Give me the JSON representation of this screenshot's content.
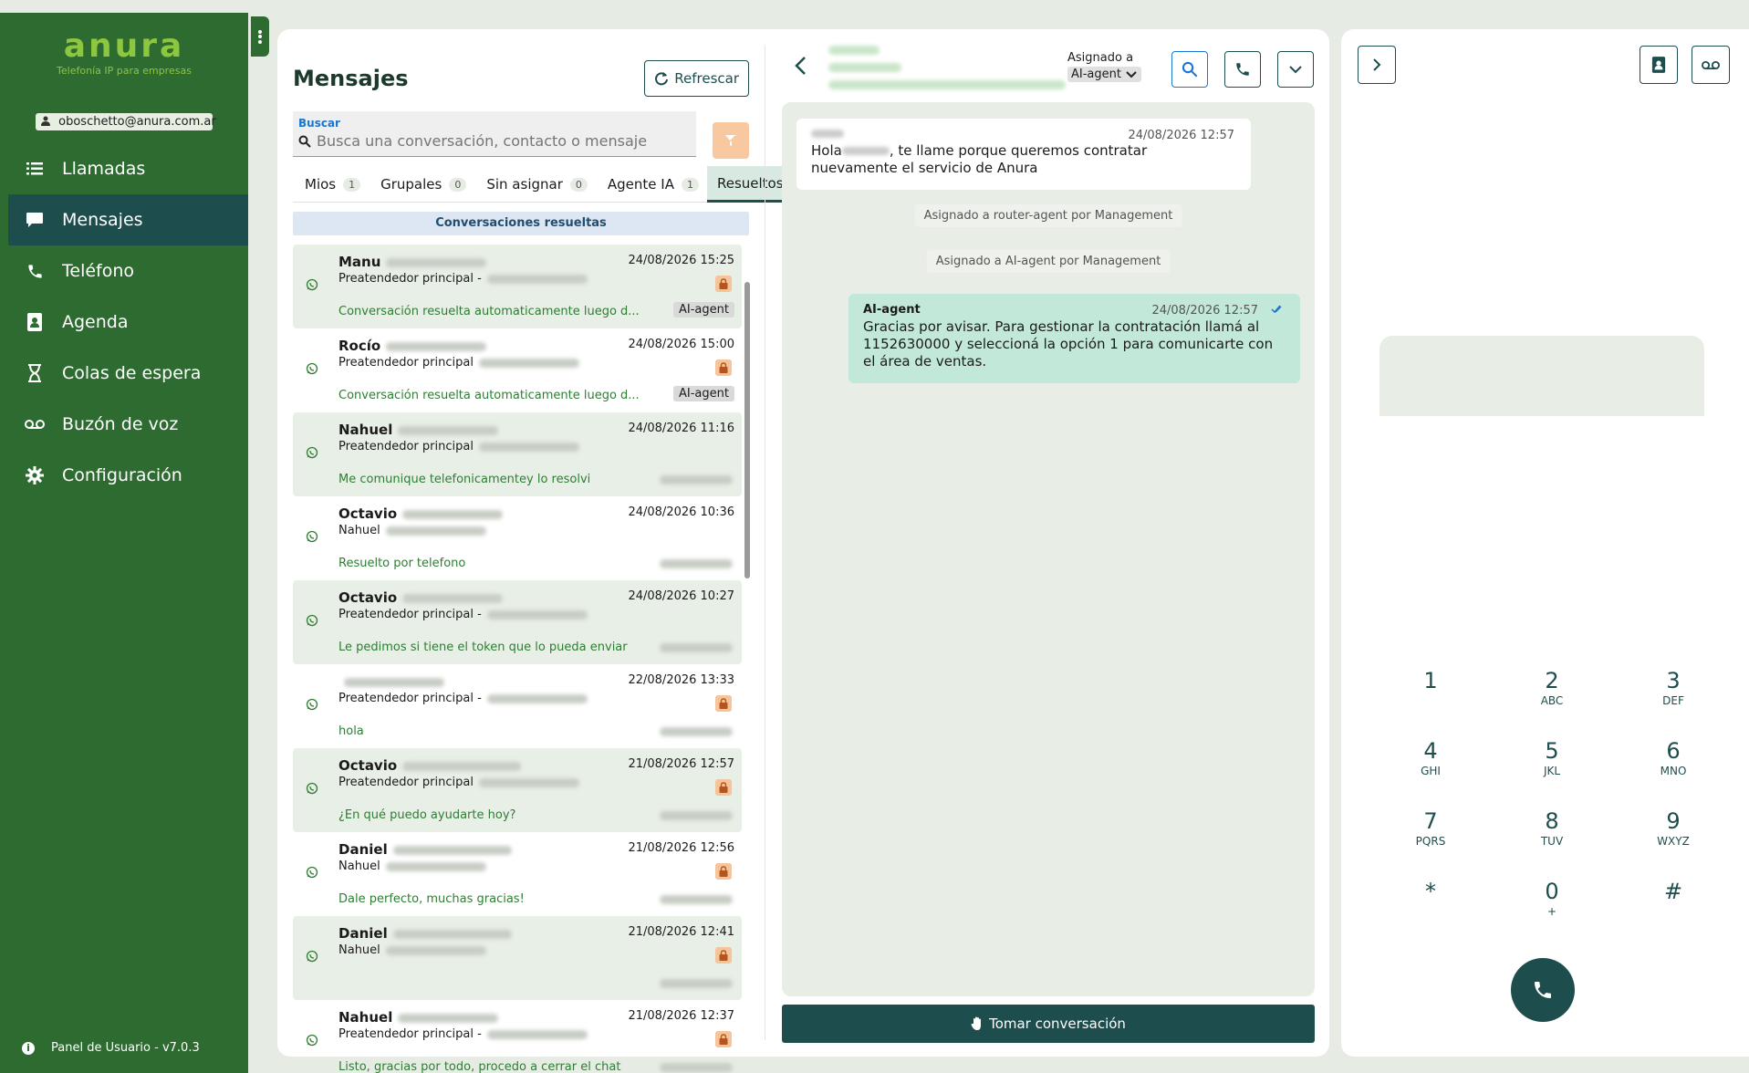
{
  "brand": {
    "logo": "anura",
    "tagline": "Telefonía IP para empresas"
  },
  "user": {
    "email": "oboschetto@anura.com.ar"
  },
  "sidebar": {
    "items": [
      {
        "label": "Llamadas",
        "icon": "list-icon"
      },
      {
        "label": "Mensajes",
        "icon": "chat-icon"
      },
      {
        "label": "Teléfono",
        "icon": "phone-icon"
      },
      {
        "label": "Agenda",
        "icon": "contact-book-icon"
      },
      {
        "label": "Colas de espera",
        "icon": "hourglass-icon"
      },
      {
        "label": "Buzón de voz",
        "icon": "voicemail-icon"
      },
      {
        "label": "Configuración",
        "icon": "gear-icon"
      }
    ],
    "footer": "Panel de Usuario - v7.0.3"
  },
  "messages": {
    "title": "Mensajes",
    "refresh_label": "Refrescar",
    "search": {
      "label": "Buscar",
      "placeholder": "Busca una conversación, contacto o mensaje"
    },
    "tabs": [
      {
        "label": "Mios",
        "count": "1"
      },
      {
        "label": "Grupales",
        "count": "0"
      },
      {
        "label": "Sin asignar",
        "count": "0"
      },
      {
        "label": "Agente IA",
        "count": "1"
      },
      {
        "label": "Resueltos",
        "count": ""
      }
    ],
    "section_title": "Conversaciones resueltas",
    "conversations": [
      {
        "name": "Manu",
        "sub": "Preatendedor principal -",
        "time": "24/08/2026 15:25",
        "preview": "Conversación resuelta automaticamente luego d...",
        "tag": "AI-agent"
      },
      {
        "name": "Rocío",
        "sub": "Preatendedor principal",
        "time": "24/08/2026 15:00",
        "preview": "Conversación resuelta automaticamente luego d...",
        "tag": "AI-agent"
      },
      {
        "name": "Nahuel",
        "sub": "Preatendedor principal",
        "time": "24/08/2026 11:16",
        "preview": "Me comunique telefonicamentey lo resolvi",
        "tag": ""
      },
      {
        "name": "Octavio",
        "sub": "Nahuel",
        "time": "24/08/2026 10:36",
        "preview": "Resuelto por telefono",
        "tag": ""
      },
      {
        "name": "Octavio",
        "sub": "Preatendedor principal -",
        "time": "24/08/2026 10:27",
        "preview": "Le pedimos si tiene el token que lo pueda enviar",
        "tag": ""
      },
      {
        "name": "",
        "sub": "Preatendedor principal -",
        "time": "22/08/2026 13:33",
        "preview": "hola",
        "tag": ""
      },
      {
        "name": "Octavio",
        "sub": "Preatendedor principal",
        "time": "21/08/2026 12:57",
        "preview": "¿En qué puedo ayudarte hoy?",
        "tag": ""
      },
      {
        "name": "Daniel",
        "sub": "Nahuel",
        "time": "21/08/2026 12:56",
        "preview": "Dale perfecto, muchas gracias!",
        "tag": ""
      },
      {
        "name": "Daniel",
        "sub": "Nahuel",
        "time": "21/08/2026 12:41",
        "preview": "",
        "tag": ""
      },
      {
        "name": "Nahuel",
        "sub": "Preatendedor principal -",
        "time": "21/08/2026 12:37",
        "preview": "Listo, gracias por todo, procedo a cerrar el chat",
        "tag": ""
      }
    ]
  },
  "chat": {
    "assigned_label": "Asignado a",
    "assigned_value": "AI-agent",
    "incoming": {
      "time": "24/08/2026 12:57",
      "text_a": "Hola",
      "text_b": ", te llame porque queremos contratar nuevamente el servicio de Anura"
    },
    "system_1": "Asignado a router-agent por Management",
    "system_2": "Asignado a AI-agent por Management",
    "outgoing": {
      "author": "AI-agent",
      "time": "24/08/2026 12:57",
      "text": "Gracias por avisar. Para gestionar la contratación llamá al 1152630000 y seleccioná la opción 1 para comunicarte con el área de ventas."
    },
    "take_label": "Tomar conversación"
  },
  "dialer": {
    "keys": [
      {
        "d": "1",
        "l": ""
      },
      {
        "d": "2",
        "l": "ABC"
      },
      {
        "d": "3",
        "l": "DEF"
      },
      {
        "d": "4",
        "l": "GHI"
      },
      {
        "d": "5",
        "l": "JKL"
      },
      {
        "d": "6",
        "l": "MNO"
      },
      {
        "d": "7",
        "l": "PQRS"
      },
      {
        "d": "8",
        "l": "TUV"
      },
      {
        "d": "9",
        "l": "WXYZ"
      },
      {
        "d": "*",
        "l": ""
      },
      {
        "d": "0",
        "l": "+"
      },
      {
        "d": "#",
        "l": ""
      }
    ]
  },
  "colors": {
    "sidebar": "#2e6b31",
    "accent": "#1e4d4e",
    "logo_green": "#8dc63f",
    "preview_green": "#2f7d34",
    "lock_orange": "#f5c49a"
  }
}
